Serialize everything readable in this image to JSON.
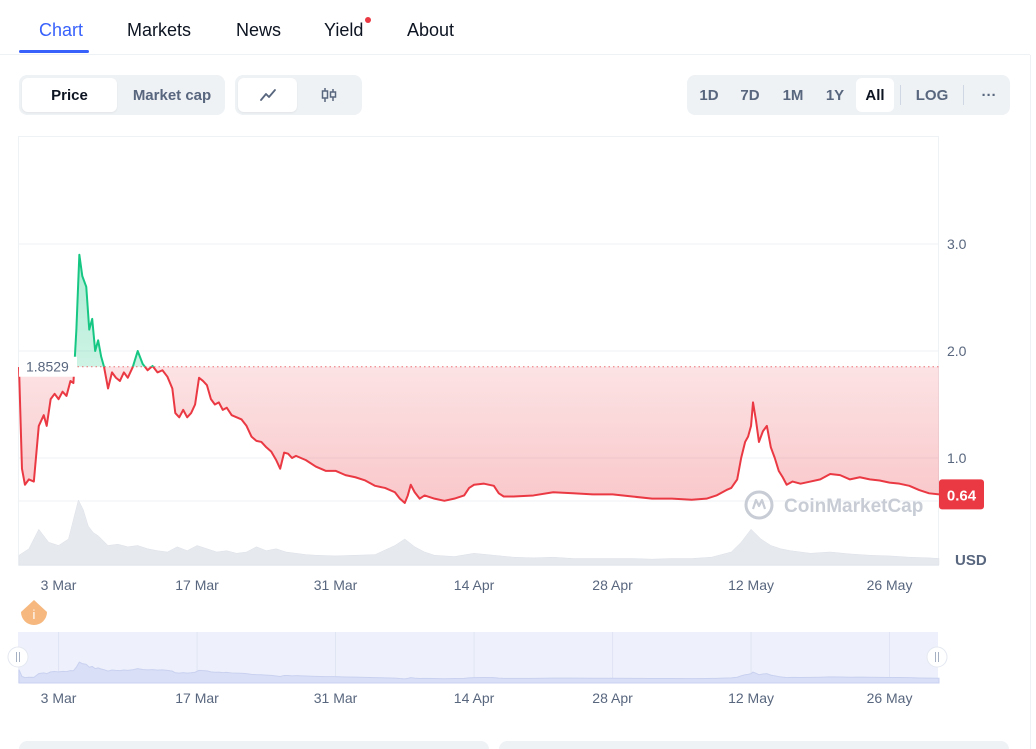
{
  "tabs": [
    {
      "label": "Chart",
      "active": true
    },
    {
      "label": "Markets",
      "active": false
    },
    {
      "label": "News",
      "active": false
    },
    {
      "label": "Yield",
      "active": false,
      "has_dot": true
    },
    {
      "label": "About",
      "active": false
    }
  ],
  "toolbar": {
    "price_label": "Price",
    "market_cap_label": "Market cap",
    "line_icon": "line-chart-icon",
    "candle_icon": "candlestick-icon",
    "ranges": [
      "1D",
      "7D",
      "1M",
      "1Y",
      "All"
    ],
    "active_range": "All",
    "log_label": "LOG",
    "more_label": "···"
  },
  "chart_data": {
    "type": "line",
    "currency_label": "USD",
    "reference_price": "1.8529",
    "reference_value": 1.8529,
    "current_price_badge": "0.64",
    "watermark": "CoinMarketCap",
    "y_ticks": [
      "3.0",
      "2.0",
      "1.0"
    ],
    "y_tick_values": [
      3.0,
      2.0,
      1.0
    ],
    "ylim": [
      0,
      4.0
    ],
    "x_tick_labels": [
      "3 Mar",
      "17 Mar",
      "31 Mar",
      "14 Apr",
      "28 Apr",
      "12 May",
      "26 May"
    ],
    "x_tick_days": [
      4,
      18,
      32,
      46,
      60,
      74,
      88
    ],
    "x_range_days": [
      0,
      93
    ],
    "series": [
      {
        "points": [
          [
            0,
            1.85
          ],
          [
            0.3,
            0.9
          ],
          [
            0.6,
            0.75
          ],
          [
            1.0,
            0.8
          ],
          [
            1.5,
            0.78
          ],
          [
            2.0,
            1.3
          ],
          [
            2.5,
            1.4
          ],
          [
            2.8,
            1.3
          ],
          [
            3.2,
            1.55
          ],
          [
            3.6,
            1.6
          ],
          [
            4.0,
            1.55
          ],
          [
            4.4,
            1.62
          ],
          [
            4.8,
            1.58
          ],
          [
            5.2,
            1.72
          ],
          [
            5.5,
            1.7
          ],
          [
            5.8,
            2.2
          ],
          [
            6.1,
            2.9
          ],
          [
            6.4,
            2.7
          ],
          [
            6.8,
            2.6
          ],
          [
            7.1,
            2.2
          ],
          [
            7.4,
            2.3
          ],
          [
            7.7,
            2.0
          ],
          [
            8.0,
            2.1
          ],
          [
            8.3,
            1.95
          ],
          [
            8.6,
            1.85
          ],
          [
            9.0,
            1.65
          ],
          [
            9.4,
            1.8
          ],
          [
            9.8,
            1.75
          ],
          [
            10.2,
            1.72
          ],
          [
            10.6,
            1.8
          ],
          [
            11.0,
            1.75
          ],
          [
            11.5,
            1.85
          ],
          [
            12.0,
            2.0
          ],
          [
            12.5,
            1.88
          ],
          [
            13.0,
            1.82
          ],
          [
            13.5,
            1.86
          ],
          [
            14.0,
            1.8
          ],
          [
            14.5,
            1.82
          ],
          [
            15.0,
            1.76
          ],
          [
            15.5,
            1.65
          ],
          [
            15.8,
            1.42
          ],
          [
            16.2,
            1.38
          ],
          [
            16.6,
            1.45
          ],
          [
            17.0,
            1.38
          ],
          [
            17.4,
            1.42
          ],
          [
            17.8,
            1.5
          ],
          [
            18.2,
            1.75
          ],
          [
            18.6,
            1.72
          ],
          [
            19.0,
            1.68
          ],
          [
            19.4,
            1.55
          ],
          [
            19.8,
            1.5
          ],
          [
            20.2,
            1.52
          ],
          [
            20.6,
            1.45
          ],
          [
            21.0,
            1.47
          ],
          [
            21.5,
            1.4
          ],
          [
            22.0,
            1.38
          ],
          [
            22.5,
            1.36
          ],
          [
            23.0,
            1.3
          ],
          [
            23.5,
            1.2
          ],
          [
            24.0,
            1.16
          ],
          [
            24.5,
            1.15
          ],
          [
            25.0,
            1.1
          ],
          [
            25.5,
            1.06
          ],
          [
            26.0,
            0.98
          ],
          [
            26.4,
            0.9
          ],
          [
            26.8,
            1.05
          ],
          [
            27.2,
            1.04
          ],
          [
            27.6,
            1.0
          ],
          [
            28.0,
            1.02
          ],
          [
            29.0,
            0.98
          ],
          [
            30.0,
            0.92
          ],
          [
            31.0,
            0.88
          ],
          [
            32.0,
            0.88
          ],
          [
            33.0,
            0.84
          ],
          [
            34.0,
            0.82
          ],
          [
            35.0,
            0.79
          ],
          [
            36.0,
            0.74
          ],
          [
            37.0,
            0.72
          ],
          [
            38.0,
            0.68
          ],
          [
            38.5,
            0.62
          ],
          [
            39.0,
            0.58
          ],
          [
            39.3,
            0.65
          ],
          [
            39.6,
            0.75
          ],
          [
            40.0,
            0.68
          ],
          [
            40.5,
            0.62
          ],
          [
            41.0,
            0.65
          ],
          [
            42.0,
            0.62
          ],
          [
            43.0,
            0.6
          ],
          [
            44.0,
            0.62
          ],
          [
            45.0,
            0.65
          ],
          [
            45.5,
            0.72
          ],
          [
            46.0,
            0.75
          ],
          [
            47.0,
            0.76
          ],
          [
            48.0,
            0.74
          ],
          [
            48.5,
            0.67
          ],
          [
            49.0,
            0.64
          ],
          [
            50.0,
            0.64
          ],
          [
            52.0,
            0.65
          ],
          [
            54.0,
            0.68
          ],
          [
            56.0,
            0.67
          ],
          [
            58.0,
            0.66
          ],
          [
            60.0,
            0.66
          ],
          [
            62.0,
            0.64
          ],
          [
            64.0,
            0.62
          ],
          [
            66.0,
            0.62
          ],
          [
            68.0,
            0.61
          ],
          [
            69.5,
            0.62
          ],
          [
            70.5,
            0.65
          ],
          [
            71.5,
            0.7
          ],
          [
            72.0,
            0.72
          ],
          [
            72.6,
            0.8
          ],
          [
            73.0,
            1.0
          ],
          [
            73.4,
            1.15
          ],
          [
            73.7,
            1.2
          ],
          [
            74.0,
            1.3
          ],
          [
            74.2,
            1.52
          ],
          [
            74.5,
            1.35
          ],
          [
            74.8,
            1.15
          ],
          [
            75.2,
            1.25
          ],
          [
            75.6,
            1.3
          ],
          [
            76.0,
            1.1
          ],
          [
            76.4,
            1.0
          ],
          [
            76.8,
            0.88
          ],
          [
            77.2,
            0.82
          ],
          [
            77.6,
            0.75
          ],
          [
            78.2,
            0.78
          ],
          [
            79.0,
            0.76
          ],
          [
            80.0,
            0.78
          ],
          [
            81.0,
            0.8
          ],
          [
            82.0,
            0.85
          ],
          [
            83.0,
            0.84
          ],
          [
            84.0,
            0.8
          ],
          [
            85.0,
            0.82
          ],
          [
            86.0,
            0.8
          ],
          [
            87.0,
            0.79
          ],
          [
            88.0,
            0.77
          ],
          [
            89.0,
            0.76
          ],
          [
            90.0,
            0.74
          ],
          [
            91.0,
            0.7
          ],
          [
            92.0,
            0.67
          ],
          [
            93.0,
            0.66
          ]
        ]
      }
    ],
    "volume": [
      [
        0,
        0.15
      ],
      [
        1,
        0.25
      ],
      [
        2,
        0.55
      ],
      [
        3,
        0.35
      ],
      [
        4,
        0.3
      ],
      [
        5,
        0.4
      ],
      [
        6,
        1.0
      ],
      [
        6.5,
        0.85
      ],
      [
        7,
        0.6
      ],
      [
        7.5,
        0.5
      ],
      [
        8,
        0.45
      ],
      [
        9,
        0.3
      ],
      [
        10,
        0.32
      ],
      [
        11,
        0.28
      ],
      [
        12,
        0.3
      ],
      [
        13,
        0.25
      ],
      [
        14,
        0.22
      ],
      [
        15,
        0.2
      ],
      [
        16,
        0.28
      ],
      [
        17,
        0.22
      ],
      [
        18,
        0.3
      ],
      [
        19,
        0.25
      ],
      [
        20,
        0.2
      ],
      [
        21,
        0.22
      ],
      [
        22,
        0.18
      ],
      [
        23,
        0.2
      ],
      [
        24,
        0.28
      ],
      [
        25,
        0.22
      ],
      [
        26,
        0.25
      ],
      [
        27,
        0.2
      ],
      [
        28,
        0.18
      ],
      [
        29,
        0.16
      ],
      [
        30,
        0.15
      ],
      [
        32,
        0.14
      ],
      [
        34,
        0.15
      ],
      [
        36,
        0.16
      ],
      [
        38,
        0.3
      ],
      [
        39,
        0.4
      ],
      [
        40,
        0.28
      ],
      [
        41,
        0.2
      ],
      [
        42,
        0.15
      ],
      [
        44,
        0.13
      ],
      [
        46,
        0.18
      ],
      [
        48,
        0.15
      ],
      [
        50,
        0.12
      ],
      [
        52,
        0.11
      ],
      [
        54,
        0.12
      ],
      [
        56,
        0.1
      ],
      [
        58,
        0.1
      ],
      [
        60,
        0.1
      ],
      [
        62,
        0.1
      ],
      [
        64,
        0.09
      ],
      [
        66,
        0.1
      ],
      [
        68,
        0.1
      ],
      [
        70,
        0.12
      ],
      [
        72,
        0.2
      ],
      [
        73,
        0.35
      ],
      [
        74,
        0.55
      ],
      [
        75,
        0.4
      ],
      [
        76,
        0.3
      ],
      [
        77,
        0.25
      ],
      [
        78,
        0.22
      ],
      [
        80,
        0.18
      ],
      [
        82,
        0.2
      ],
      [
        84,
        0.17
      ],
      [
        86,
        0.15
      ],
      [
        88,
        0.14
      ],
      [
        90,
        0.12
      ],
      [
        92,
        0.11
      ],
      [
        93,
        0.1
      ]
    ]
  }
}
